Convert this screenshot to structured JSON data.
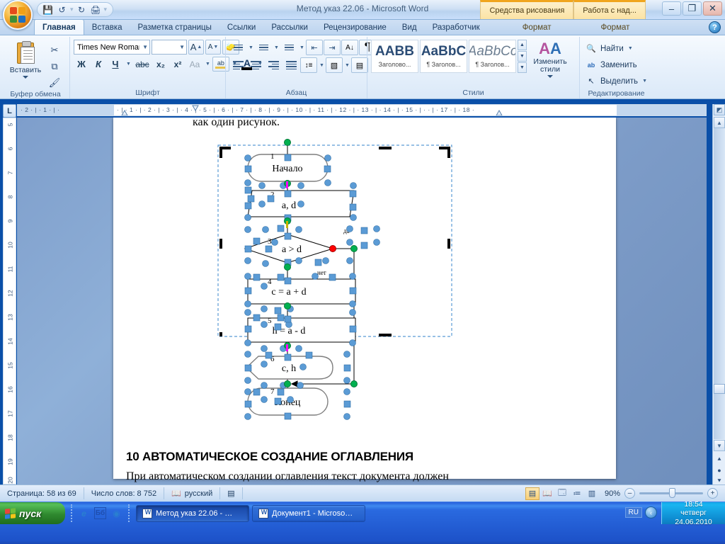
{
  "window": {
    "title": "Метод указ 22.06  -  Microsoft Word",
    "quick_access": {
      "save_icon": "save-icon",
      "undo_icon": "undo-icon",
      "redo_icon": "redo-icon",
      "print_icon": "print-preview-icon",
      "more_icon": "customize-qat-icon"
    },
    "contextual_tabs": [
      {
        "label": "Средства рисования"
      },
      {
        "label": "Работа с над..."
      }
    ],
    "controls": {
      "minimize": "–",
      "restore": "❐",
      "close": "✕"
    }
  },
  "ribbon": {
    "tabs": [
      {
        "label": "Главная",
        "active": true
      },
      {
        "label": "Вставка",
        "active": false
      },
      {
        "label": "Разметка страницы",
        "active": false
      },
      {
        "label": "Ссылки",
        "active": false
      },
      {
        "label": "Рассылки",
        "active": false
      },
      {
        "label": "Рецензирование",
        "active": false
      },
      {
        "label": "Вид",
        "active": false
      },
      {
        "label": "Разработчик",
        "active": false
      },
      {
        "label": "Формат",
        "active": false,
        "contextual": true
      },
      {
        "label": "Формат",
        "active": false,
        "contextual": true
      }
    ],
    "help_label": "?",
    "groups": {
      "clipboard": {
        "title": "Буфер обмена",
        "paste_label": "Вставить",
        "cut_icon": "scissors-icon",
        "copy_icon": "copy-icon",
        "format_painter_icon": "format-painter-icon"
      },
      "font": {
        "title": "Шрифт",
        "font_name": "Times New Roman",
        "font_size": "",
        "grow_label": "A",
        "shrink_label": "A",
        "clear_format_icon": "clear-formatting-icon",
        "bold_label": "Ж",
        "italic_label": "К",
        "underline_label": "Ч",
        "strike_label": "abc",
        "subscript_label": "x₂",
        "superscript_label": "x²",
        "change_case_label": "Aa",
        "highlight_label": "ab",
        "fontcolor_label": "A"
      },
      "paragraph": {
        "title": "Абзац",
        "bullets_icon": "bullet-list-icon",
        "numbering_icon": "numbered-list-icon",
        "multilevel_icon": "multilevel-list-icon",
        "indent_dec_icon": "decrease-indent-icon",
        "indent_inc_icon": "increase-indent-icon",
        "sort_icon": "sort-icon",
        "marks_label": "¶",
        "align_left_icon": "align-left-icon",
        "align_center_icon": "align-center-icon",
        "align_right_icon": "align-right-icon",
        "justify_icon": "justify-icon",
        "linespacing_icon": "line-spacing-icon",
        "shading_icon": "shading-icon",
        "borders_icon": "borders-icon"
      },
      "styles": {
        "title": "Стили",
        "items": [
          {
            "preview": "AABB",
            "name": "Заголово..."
          },
          {
            "preview": "AaBbC",
            "name": "¶ Заголов..."
          },
          {
            "preview": "AaBbCc",
            "name": "¶ Заголов..."
          }
        ],
        "change_styles_label": "Изменить стили"
      },
      "editing": {
        "title": "Редактирование",
        "items": [
          {
            "label": "Найти",
            "icon": "binoculars-icon",
            "has_arrow": true
          },
          {
            "label": "Заменить",
            "icon": "replace-icon",
            "has_arrow": false
          },
          {
            "label": "Выделить",
            "icon": "select-pointer-icon",
            "has_arrow": true
          }
        ]
      }
    }
  },
  "rulers": {
    "tab_selector_label": "L",
    "horizontal_left": "·  2  ·  |  ·  1  ·  |  ·  ",
    "horizontal_main": "·  |  ·  1  ·  |  ·  2  ·  |  ·  3  ·  |  ·  4  ·  |  ·  5  ·  |  ·  6  ·  |  ·  7  ·  |  ·  8  ·  |  ·  9  ·  |  · 10 ·  |  · 11 ·  |  · 12 ·  |  · 13 ·  |  · 14 ·  |  · 15 ·  |  ·      ·  |  · 17 ·  |  · 18 ·",
    "vertical_ticks": [
      "5",
      "6",
      "7",
      "8",
      "9",
      "10",
      "11",
      "12",
      "13",
      "14",
      "15",
      "16",
      "17",
      "18",
      "19",
      "20"
    ]
  },
  "document": {
    "text_above": "как один рисунок.",
    "heading": "10 АВТОМАТИЧЕСКОЕ СОЗДАНИЕ ОГЛАВЛЕНИЯ",
    "paragraph": "При автоматическом создании оглавления текст документа должен",
    "flowchart": {
      "selected": true,
      "nodes": [
        {
          "num": "1",
          "label": "Начало",
          "shape": "terminator"
        },
        {
          "num": "2",
          "label": "a, d",
          "shape": "parallelogram"
        },
        {
          "num": "3",
          "label": "a > d",
          "shape": "decision"
        },
        {
          "num": "4",
          "label": "c = a + d",
          "shape": "process"
        },
        {
          "num": "5",
          "label": "h = a - d",
          "shape": "process"
        },
        {
          "num": "6",
          "label": "c, h",
          "shape": "output"
        },
        {
          "num": "7",
          "label": "Конец",
          "shape": "terminator"
        }
      ],
      "branch_labels": {
        "yes": "да",
        "no": "нет"
      }
    }
  },
  "status_bar": {
    "page": "Страница: 58 из 69",
    "words": "Число слов: 8 752",
    "language": "русский",
    "proof_icon": "spellcheck-icon",
    "macro_icon": "record-macro-icon",
    "views": [
      {
        "icon": "print-layout-icon",
        "active": true
      },
      {
        "icon": "full-screen-reading-icon",
        "active": false
      },
      {
        "icon": "web-layout-icon",
        "active": false
      },
      {
        "icon": "outline-icon",
        "active": false
      },
      {
        "icon": "draft-icon",
        "active": false
      }
    ],
    "zoom": "90%",
    "zoom_out_label": "–",
    "zoom_in_label": "+"
  },
  "taskbar": {
    "start_label": "пуск",
    "quick_launch": [
      {
        "icon": "internet-explorer-icon"
      },
      {
        "icon": "bb-icon"
      },
      {
        "icon": "media-icon"
      }
    ],
    "tasks": [
      {
        "label": "Метод указ 22.06 - …",
        "active": true
      },
      {
        "label": "Документ1 - Microso…",
        "active": false
      }
    ],
    "language_indicator": "RU",
    "tray_chevron": "‹",
    "clock": {
      "time": "18:54",
      "day": "четверг",
      "date": "24.06.2010"
    }
  },
  "colors": {
    "accent": "#1b4f8f",
    "selection_handle": "#6fa8dc",
    "connector_green": "#00b050",
    "connector_red": "#ff0000",
    "highlight_orange": "#f0a51e"
  }
}
